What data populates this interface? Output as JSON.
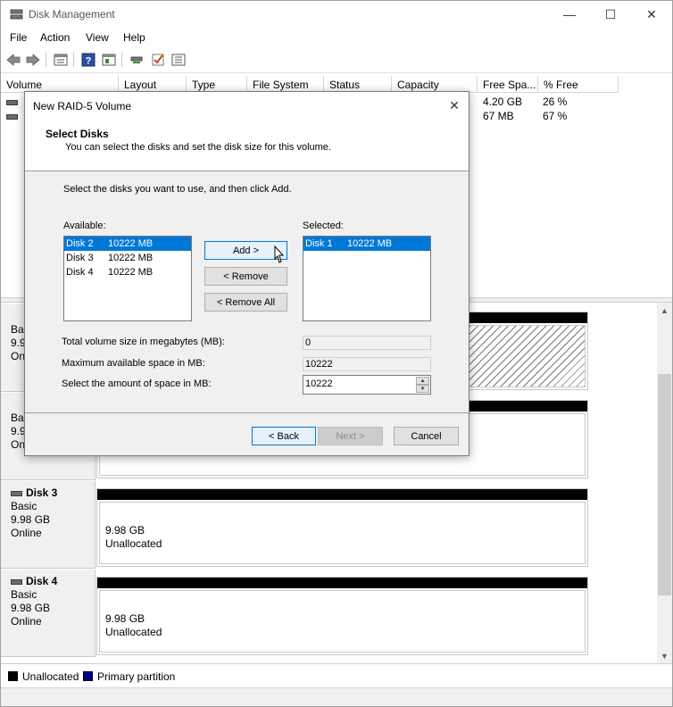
{
  "window": {
    "title": "Disk Management",
    "minimize_glyph": "—",
    "maximize_glyph": "☐",
    "close_glyph": "✕"
  },
  "menu": {
    "file": "File",
    "action": "Action",
    "view": "View",
    "help": "Help"
  },
  "toolbar_icons": [
    "back-icon",
    "forward-icon",
    "properties-icon",
    "help-icon",
    "show-hide-icon",
    "rescan-icon",
    "check-icon",
    "list-icon"
  ],
  "volume_list": {
    "columns": [
      "Volume",
      "Layout",
      "Type",
      "File System",
      "Status",
      "Capacity",
      "Free Spa...",
      "% Free"
    ],
    "rows": [
      {
        "free_space": "4.20 GB",
        "pct_free": "26 %"
      },
      {
        "free_space": "67 MB",
        "pct_free": "67 %"
      }
    ]
  },
  "disks": [
    {
      "name": "",
      "type": "Basic",
      "size": "9.9",
      "status": "On"
    },
    {
      "name": "",
      "type": "Basic",
      "size": "9.9",
      "status": "On"
    },
    {
      "name": "Disk 3",
      "type": "Basic",
      "size": "9.98 GB",
      "status": "Online",
      "vol_size": "9.98 GB",
      "vol_status": "Unallocated"
    },
    {
      "name": "Disk 4",
      "type": "Basic",
      "size": "9.98 GB",
      "status": "Online",
      "vol_size": "9.98 GB",
      "vol_status": "Unallocated"
    }
  ],
  "legend": {
    "unallocated": "Unallocated",
    "primary": "Primary partition",
    "unallocated_color": "#000000",
    "primary_color": "#00008b"
  },
  "dialog": {
    "title": "New RAID-5 Volume",
    "heading": "Select Disks",
    "subheading": "You can select the disks and set the disk size for this volume.",
    "instruction": "Select the disks you want to use, and then click Add.",
    "available_label": "Available:",
    "selected_label": "Selected:",
    "available": [
      {
        "disk": "Disk 2",
        "size": "10222 MB",
        "selected": true
      },
      {
        "disk": "Disk 3",
        "size": "10222 MB",
        "selected": false
      },
      {
        "disk": "Disk 4",
        "size": "10222 MB",
        "selected": false
      }
    ],
    "selected": [
      {
        "disk": "Disk 1",
        "size": "10222 MB",
        "selected": true
      }
    ],
    "add_button": "Add >",
    "remove_button": "< Remove",
    "remove_all_button": "< Remove All",
    "total_label": "Total volume size in megabytes (MB):",
    "total_value": "0",
    "max_label": "Maximum available space in MB:",
    "max_value": "10222",
    "amount_label": "Select the amount of space in MB:",
    "amount_value": "10222",
    "back_button": "< Back",
    "next_button": "Next >",
    "cancel_button": "Cancel",
    "close_glyph": "✕"
  }
}
